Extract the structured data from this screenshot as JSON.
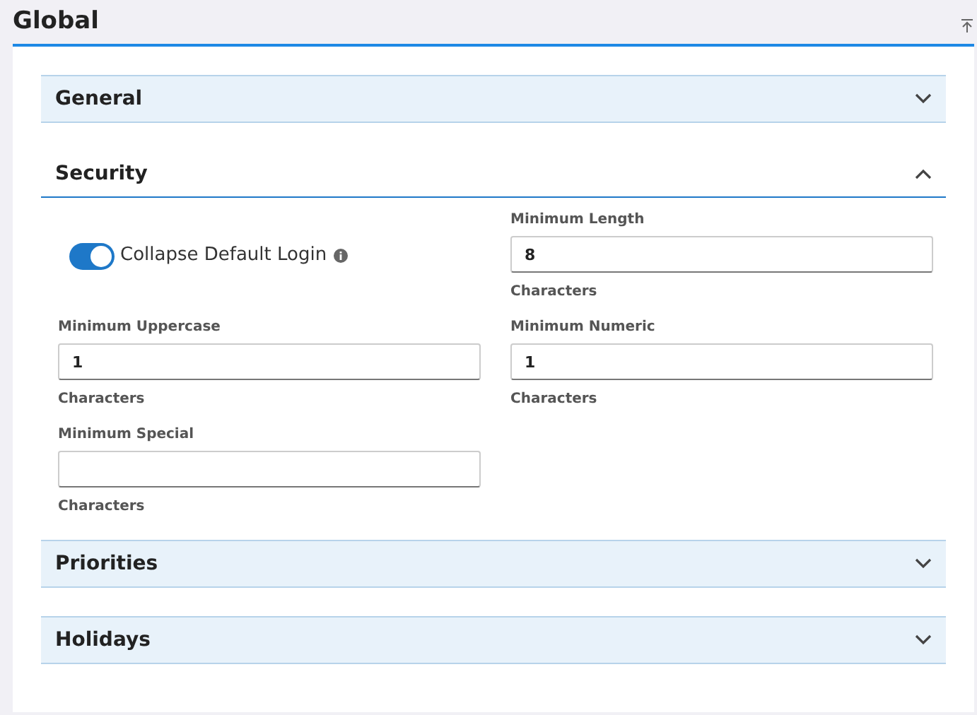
{
  "page": {
    "title": "Global"
  },
  "sections": [
    {
      "title": "General",
      "expanded": false
    },
    {
      "title": "Security",
      "expanded": true,
      "fields": [
        {
          "kind": "toggle",
          "label": "Collapse Default Login",
          "on": true
        },
        {
          "kind": "number",
          "label": "Minimum Length",
          "value": "8",
          "unit": "Characters"
        },
        {
          "kind": "number",
          "label": "Minimum Uppercase",
          "value": "1",
          "unit": "Characters"
        },
        {
          "kind": "number",
          "label": "Minimum Numeric",
          "value": "1",
          "unit": "Characters"
        },
        {
          "kind": "number",
          "label": "Minimum Special",
          "unit": "Characters"
        }
      ]
    },
    {
      "title": "Priorities",
      "expanded": false
    },
    {
      "title": "Holidays",
      "expanded": false
    }
  ]
}
